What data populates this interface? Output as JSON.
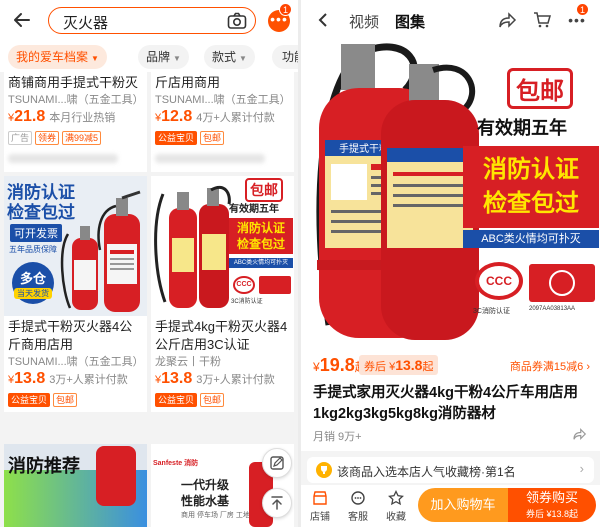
{
  "search": {
    "query": "灭火器"
  },
  "badge_count": "1",
  "filters": [
    {
      "label": "我的爱车档案"
    },
    {
      "label": "品牌"
    },
    {
      "label": "款式"
    },
    {
      "label": "功能"
    }
  ],
  "products": [
    {
      "title": "商铺商用手提式干粉灭",
      "shop": "TSUNAMI...啸（五金工具）",
      "price_int": "21.8",
      "sold": "本月行业热销",
      "tags": [
        "广告",
        "领券",
        "满99减5"
      ]
    },
    {
      "title": "斤店用商用",
      "shop": "TSUNAMI...啸（五金工具）",
      "price_int": "12.8",
      "sold": "4万+人累计付款",
      "tags": [
        "公益宝贝",
        "包邮"
      ]
    },
    {
      "title": "手提式干粉灭火器4公斤商用店用",
      "shop": "TSUNAMI...啸（五金工具）",
      "price_int": "13.8",
      "sold": "3万+人累计付款",
      "tags": [
        "公益宝贝",
        "包邮"
      ],
      "img_text": {
        "l1": "消防认证",
        "l2": "检查包过",
        "l3": "可开发票",
        "l4": "五年品质保障",
        "l5": "多仓",
        "l6": "当天发货"
      }
    },
    {
      "title": "手提式4kg干粉灭火器4公斤店用3C认证",
      "shop": "龙聚云丨干粉",
      "price_int": "13.8",
      "sold": "3万+人累计付款",
      "tags": [
        "公益宝贝",
        "包邮"
      ],
      "img_text": {
        "l1": "包邮",
        "l2": "有效期五年",
        "l3": "消防认证",
        "l4": "检查包过",
        "l5": "ABC类火情均可扑灭",
        "l6": "3C消防认证"
      }
    },
    {
      "img_text": {
        "l1": "消防推荐"
      }
    },
    {
      "img_text": {
        "brand": "Sanfeste 消防",
        "l1": "一代升级",
        "l2": "性能水基",
        "l3": "商用 停车场 厂房 工地"
      }
    }
  ],
  "currency": "¥",
  "detail": {
    "tabs": [
      "视频",
      "图集"
    ],
    "promo": {
      "free_ship": "包邮",
      "validity": "有效期五年",
      "cert1": "消防认证",
      "cert2": "检查包过",
      "abc": "ABC类火情均可扑灭",
      "ccc": "3C消防认证",
      "cert_no": "2097AA03813AA"
    },
    "label_text": "手提式干粉灭火器",
    "price": "19.8",
    "price_suffix": "起",
    "coupon_label": "券后",
    "coupon_price": "13.8",
    "coupon_suffix": "起",
    "voucher": "商品券满15减6 ›",
    "title": "手提式家用灭火器4kg干粉4公斤车用店用1kg2kg3kg5kg8kg消防器材",
    "monthly": "月销 9万+",
    "rank": "该商品入选本店人气收藏榜·第1名",
    "bottom": {
      "shop": "店铺",
      "service": "客服",
      "fav": "收藏",
      "cart": "加入购物车",
      "buy": "领券购买",
      "buy_sub": "券后 ¥13.8起"
    }
  },
  "colors": {
    "accent": "#ff5000",
    "cart": "#ff9a1e",
    "cylinder": "#d71f24"
  }
}
